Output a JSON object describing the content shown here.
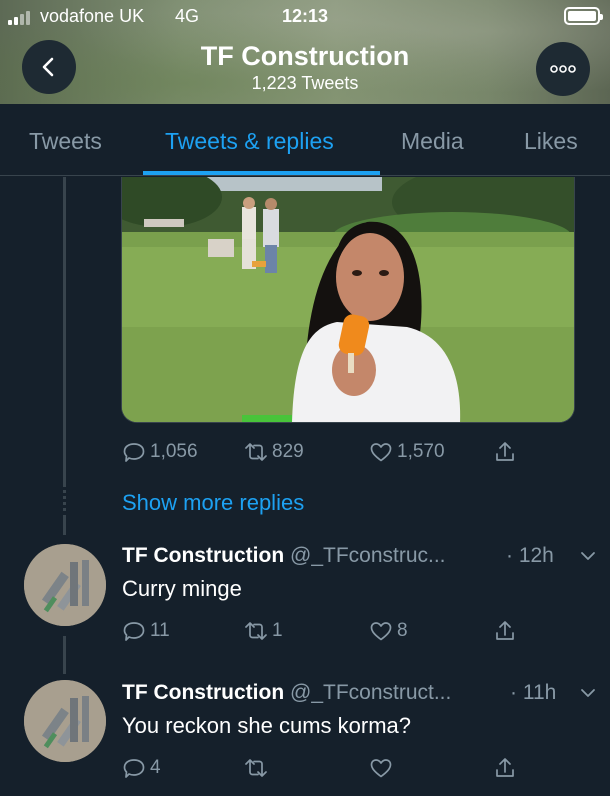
{
  "status_bar": {
    "carrier": "vodafone UK",
    "network": "4G",
    "time": "12:13"
  },
  "header": {
    "name": "TF Construction",
    "tweet_count": "1,223 Tweets"
  },
  "tabs": [
    {
      "label": "Tweets",
      "active": false
    },
    {
      "label": "Tweets & replies",
      "active": true
    },
    {
      "label": "Media",
      "active": false
    },
    {
      "label": "Likes",
      "active": false
    }
  ],
  "main_tweet": {
    "replies": "1,056",
    "retweets": "829",
    "likes": "1,570"
  },
  "show_more_replies": "Show more replies",
  "replies": [
    {
      "name": "TF Construction",
      "handle": "@_TFconstruc...",
      "time": "· 12h",
      "text": "Curry minge",
      "reply_count": "11",
      "retweet_count": "1",
      "like_count": "8"
    },
    {
      "name": "TF Construction",
      "handle": "@_TFconstruct...",
      "time": "· 11h",
      "text": "You reckon she cums korma?",
      "reply_count": "4",
      "retweet_count": "",
      "like_count": ""
    }
  ],
  "colors": {
    "background": "#15202b",
    "accent": "#1da1f2",
    "muted": "#8899a6",
    "divider": "#38444d"
  }
}
